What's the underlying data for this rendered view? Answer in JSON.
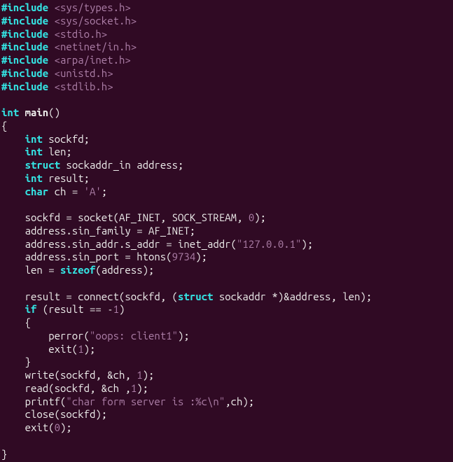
{
  "code": {
    "inc1_kw": "#include ",
    "inc1_hdr": "<sys/types.h>",
    "inc2_kw": "#include ",
    "inc2_hdr": "<sys/socket.h>",
    "inc3_kw": "#include ",
    "inc3_hdr": "<stdio.h>",
    "inc4_kw": "#include ",
    "inc4_hdr": "<netinet/in.h>",
    "inc5_kw": "#include ",
    "inc5_hdr": "<arpa/inet.h>",
    "inc6_kw": "#include ",
    "inc6_hdr": "<unistd.h>",
    "inc7_kw": "#include ",
    "inc7_hdr": "<stdlib.h>",
    "main_ret": "int",
    "main_name": " main",
    "main_parens": "()",
    "brace_o": "{",
    "decl1_pad": "    ",
    "decl1_kw": "int",
    "decl1_rest": " sockfd;",
    "decl2_pad": "    ",
    "decl2_kw": "int",
    "decl2_rest": " len;",
    "decl3_pad": "    ",
    "decl3_kw": "struct",
    "decl3_rest": " sockaddr_in address;",
    "decl4_pad": "    ",
    "decl4_kw": "int",
    "decl4_rest": " result;",
    "decl5_pad": "    ",
    "decl5_kw": "char",
    "decl5_mid": " ch = ",
    "decl5_lit": "'A'",
    "decl5_end": ";",
    "sock_pad": "    ",
    "sock_a": "sockfd = socket(AF_INET, SOCK_STREAM, ",
    "sock_n": "0",
    "sock_b": ");",
    "fam_pad": "    ",
    "fam": "address.sin_family = AF_INET;",
    "addr_pad": "    ",
    "addr_a": "address.sin_addr.s_addr = inet_addr(",
    "addr_s": "\"127.0.0.1\"",
    "addr_b": ");",
    "port_pad": "    ",
    "port_a": "address.sin_port = htons(",
    "port_n": "9734",
    "port_b": ");",
    "len_pad": "    ",
    "len_a": "len = ",
    "len_kw": "sizeof",
    "len_b": "(address);",
    "conn_pad": "    ",
    "conn_a": "result = connect(sockfd, (",
    "conn_kw": "struct",
    "conn_b": " sockaddr *)&address, len);",
    "if_pad": "    ",
    "if_kw": "if",
    "if_a": " (result == -",
    "if_n": "1",
    "if_b": ")",
    "if_bo_pad": "    ",
    "if_bo": "{",
    "perr_pad": "        ",
    "perr_a": "perror(",
    "perr_s": "\"oops: client1\"",
    "perr_b": ");",
    "exit_pad": "        ",
    "exit_a": "exit(",
    "exit_n": "1",
    "exit_b": ");",
    "if_bc_pad": "    ",
    "if_bc": "}",
    "wr_pad": "    ",
    "wr_a": "write(sockfd, &ch, ",
    "wr_n": "1",
    "wr_b": ");",
    "rd_pad": "    ",
    "rd_a": "read(sockfd, &ch ,",
    "rd_n": "1",
    "rd_b": ");",
    "pf_pad": "    ",
    "pf_a": "printf(",
    "pf_s": "\"char form server is :%c\\n\"",
    "pf_b": ",ch);",
    "cl_pad": "    ",
    "cl": "close(sockfd);",
    "ex0_pad": "    ",
    "ex0_a": "exit(",
    "ex0_n": "0",
    "ex0_b": ");",
    "brace_c": "}"
  }
}
